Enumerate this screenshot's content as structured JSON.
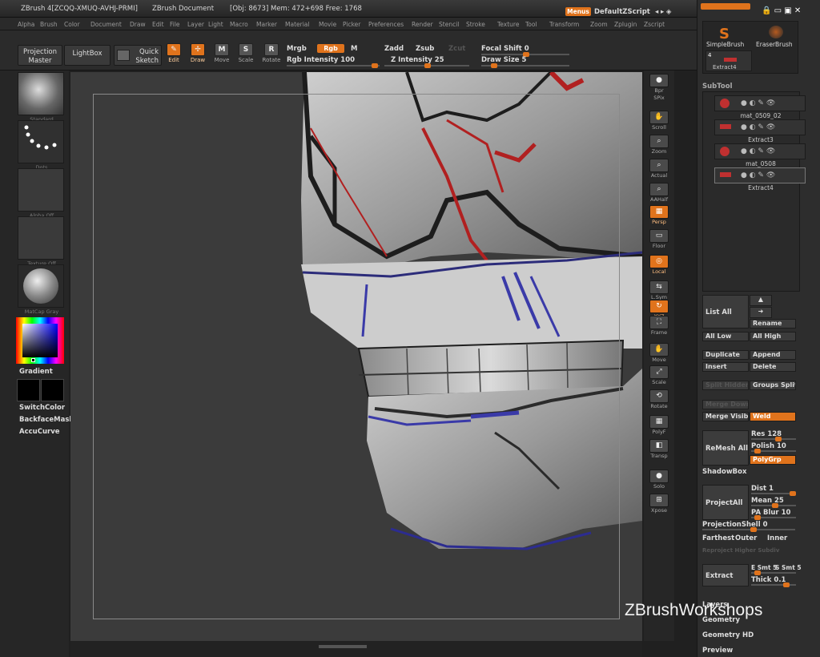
{
  "titlebar": {
    "app_title": "ZBrush 4[ZCQQ-XMUQ-AVHJ-PRMI]",
    "document": "ZBrush Document",
    "stats": "[Obj: 8673] Mem: 472+698 Free: 1768",
    "menus_btn": "Menus",
    "script": "DefaultZScript",
    "arrows": "◂ ▸ ◈"
  },
  "menubar": [
    "Alpha",
    "Brush",
    "Color",
    "Document",
    "Draw",
    "Edit",
    "File",
    "Layer",
    "Light",
    "Macro",
    "Marker",
    "Material",
    "Movie",
    "Picker",
    "Preferences",
    "Render",
    "Stencil",
    "Stroke",
    "Texture",
    "Tool",
    "Transform",
    "Zoom",
    "Zplugin",
    "Zscript"
  ],
  "shelf": {
    "projection_master": "Projection Master",
    "lightbox": "LightBox",
    "quick_sketch": "Quick Sketch",
    "tools": [
      {
        "label": "Edit",
        "glyph": "✎",
        "on": true
      },
      {
        "label": "Draw",
        "glyph": "✢",
        "on": true
      },
      {
        "label": "Move",
        "glyph": "M",
        "on": false
      },
      {
        "label": "Scale",
        "glyph": "S",
        "on": false
      },
      {
        "label": "Rotate",
        "glyph": "R",
        "on": false
      }
    ],
    "mrgb": "Mrgb",
    "rgb": "Rgb",
    "m": "M",
    "rgb_intensity": "Rgb Intensity 100",
    "zadd": "Zadd",
    "zsub": "Zsub",
    "zcut": "Zcut",
    "z_intensity": "Z Intensity 25",
    "focal_shift": "Focal Shift 0",
    "draw_size": "Draw Size 5"
  },
  "lefttray": {
    "brush_cap": "Standard",
    "stroke_cap": "Dots",
    "alpha_cap": "Alpha Off",
    "texture_cap": "Texture Off",
    "material_cap": "MatCap Gray",
    "gradient": "Gradient",
    "switchcolor": "SwitchColor",
    "backface": "BackfaceMask",
    "accucurve": "AccuCurve"
  },
  "rtools": [
    {
      "label": "Bpr",
      "glyph": "●",
      "on": false
    },
    {
      "label": "SPix",
      "glyph": "",
      "on": false
    },
    {
      "label": "Scroll",
      "glyph": "✋",
      "on": false
    },
    {
      "label": "Zoom",
      "glyph": "⌕",
      "on": false
    },
    {
      "label": "Actual",
      "glyph": "⌕",
      "on": false
    },
    {
      "label": "AAHalf",
      "glyph": "⌕",
      "on": false
    },
    {
      "label": "Persp",
      "glyph": "▦",
      "on": true
    },
    {
      "label": "Floor",
      "glyph": "▭",
      "on": false
    },
    {
      "label": "Local",
      "glyph": "◎",
      "on": true
    },
    {
      "label": "L.Sym",
      "glyph": "⇆",
      "on": false
    },
    {
      "label": "XYZ",
      "glyph": "↻",
      "on": true
    },
    {
      "label": "Frame",
      "glyph": "⛶",
      "on": false
    },
    {
      "label": "Move",
      "glyph": "✋",
      "on": false
    },
    {
      "label": "Scale",
      "glyph": "⤢",
      "on": false
    },
    {
      "label": "Rotate",
      "glyph": "⟲",
      "on": false
    },
    {
      "label": "PolyF",
      "glyph": "▦",
      "on": false
    },
    {
      "label": "Transp",
      "glyph": "◧",
      "on": false
    },
    {
      "label": "Solo",
      "glyph": "●",
      "on": false
    },
    {
      "label": "Xpose",
      "glyph": "⊞",
      "on": false
    }
  ],
  "rpanel": {
    "brush1": "SimpleBrush",
    "brush2": "EraserBrush",
    "brush3": "Extract4",
    "brush3_count": "4",
    "subtool_header": "SubTool",
    "subtools": [
      "mat_0509_02",
      "Extract3",
      "mat_0508",
      "Extract4"
    ],
    "list_all": "List All",
    "rename": "Rename",
    "all_low": "All Low",
    "all_high": "All High",
    "duplicate": "Duplicate",
    "append": "Append",
    "insert": "Insert",
    "delete": "Delete",
    "split_hidden": "Split Hidden",
    "groups_split": "Groups Split",
    "merge_down": "Merge Down",
    "merge_visible": "Merge Visible",
    "weld": "Weld",
    "remesh_all": "ReMesh All",
    "res": "Res 128",
    "polish": "Polish 10",
    "polygrp": "PolyGrp",
    "shadowbox": "ShadowBox",
    "project_all": "ProjectAll",
    "dist": "Dist 1",
    "mean": "Mean 25",
    "pa_blur": "PA Blur 10",
    "projection_shell": "ProjectionShell 0",
    "farthest": "Farthest",
    "outer": "Outer",
    "inner": "Inner",
    "reproject": "Reproject Higher Subdiv",
    "extract": "Extract",
    "e_smt": "E Smt 5",
    "s_smt": "S Smt 5",
    "thick": "Thick 0.1",
    "layers": "Layers",
    "geometry": "Geometry",
    "geometry_hd": "Geometry HD",
    "preview": "Preview"
  },
  "watermark": "ZBrushWorkshops",
  "colors": {
    "accent": "#e0731c",
    "panel": "#2d2d2d",
    "canvas": "#3b3b3b"
  }
}
